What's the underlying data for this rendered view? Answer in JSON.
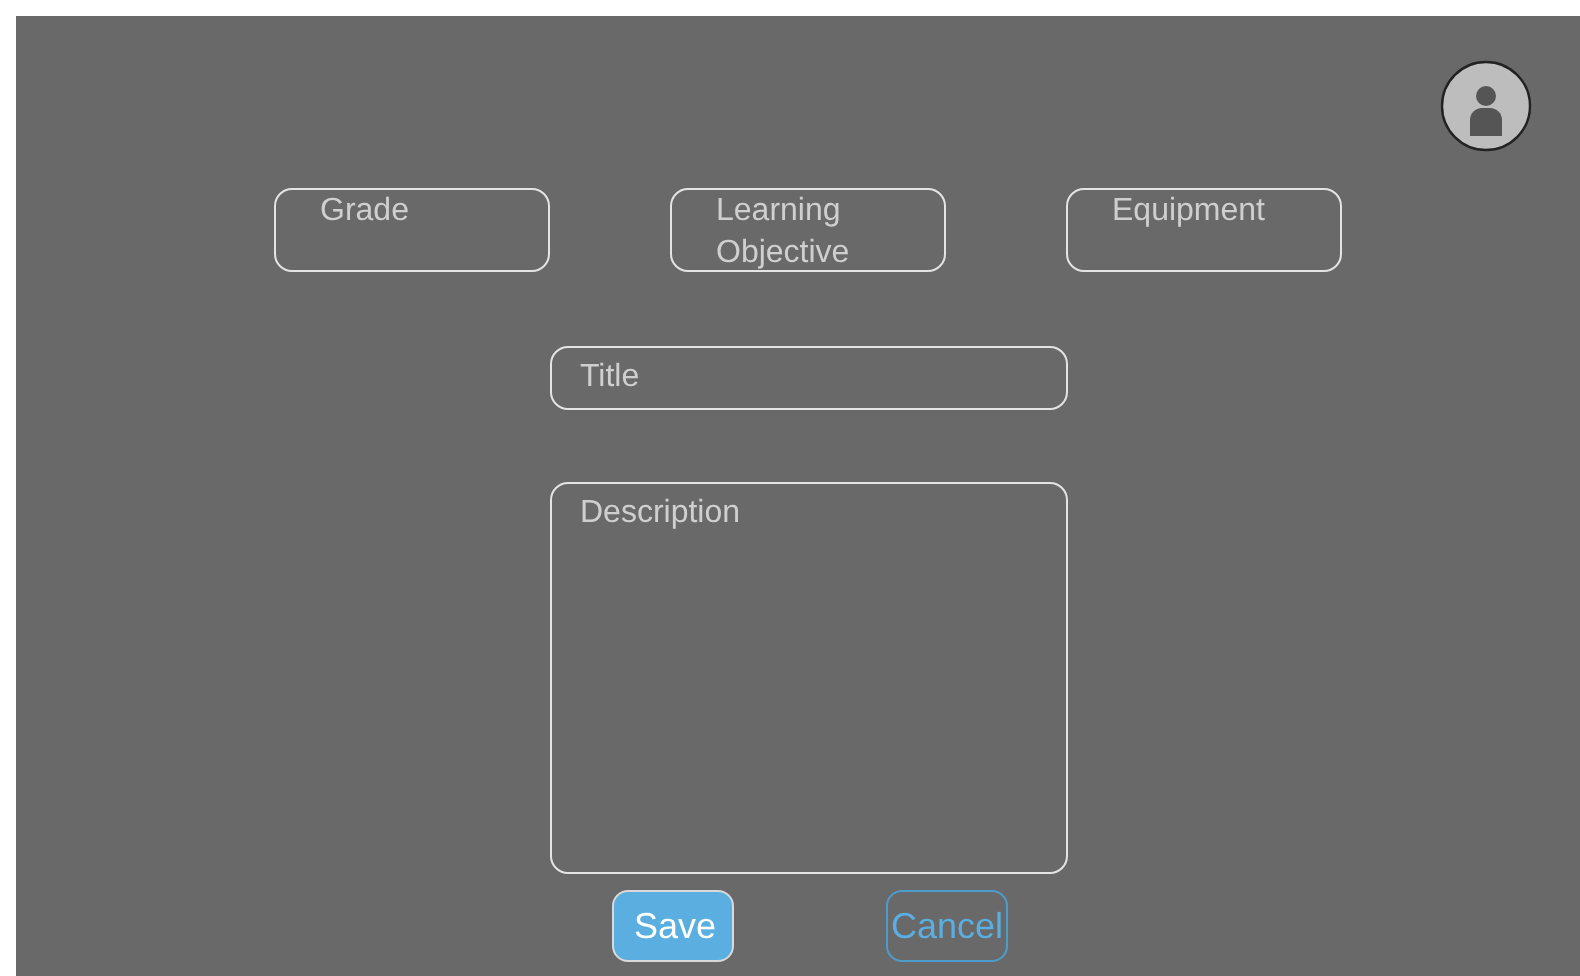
{
  "filters": [
    {
      "placeholder": "Grade"
    },
    {
      "placeholder": "Learning Objective"
    },
    {
      "placeholder": "Equipment"
    }
  ],
  "title_field": {
    "placeholder": "Title"
  },
  "description_field": {
    "placeholder": "Description"
  },
  "buttons": [
    {
      "label": "Save",
      "kind": "primary"
    },
    {
      "label": "Cancel",
      "kind": "secondary"
    }
  ]
}
